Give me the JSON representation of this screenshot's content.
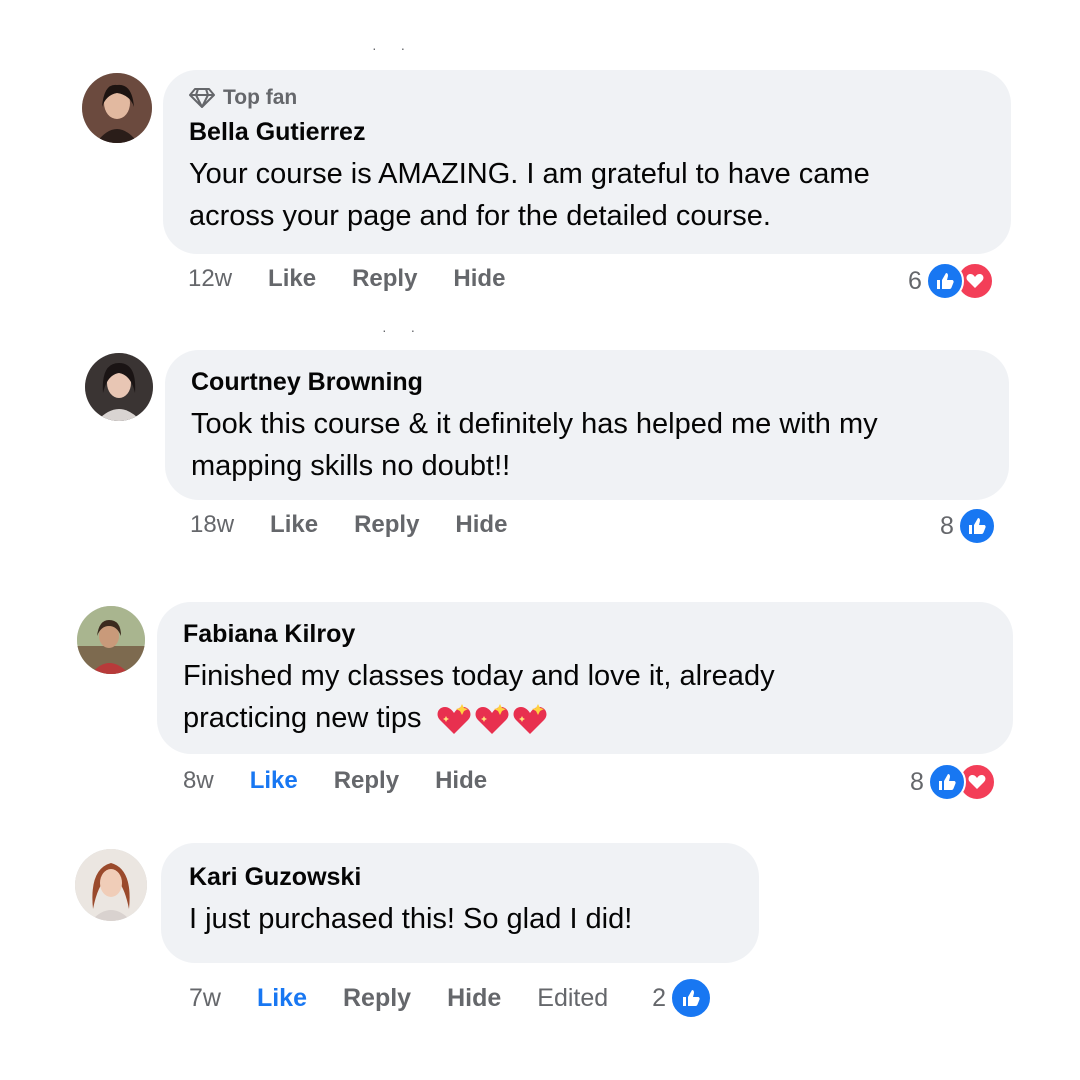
{
  "comments": [
    {
      "badge": "Top fan",
      "name": "Bella Gutierrez",
      "text_line1": "Your course is AMAZING. I am grateful to have came",
      "text_line2": "across your page and for the detailed course.",
      "time": "12w",
      "like": "Like",
      "reply": "Reply",
      "hide": "Hide",
      "reaction_count": "6",
      "reactions": [
        "like-icon",
        "love-icon"
      ],
      "liked": false
    },
    {
      "name": "Courtney Browning",
      "text_line1": "Took this course & it definitely has helped me with my",
      "text_line2": "mapping skills no doubt!!",
      "time": "18w",
      "like": "Like",
      "reply": "Reply",
      "hide": "Hide",
      "reaction_count": "8",
      "reactions": [
        "like-icon"
      ],
      "liked": false
    },
    {
      "name": "Fabiana Kilroy",
      "text_line1": "Finished my classes today and love it, already",
      "text_line2": "practicing new tips",
      "emoji": "sparkling-heart-icon",
      "time": "8w",
      "like": "Like",
      "reply": "Reply",
      "hide": "Hide",
      "reaction_count": "8",
      "reactions": [
        "like-icon",
        "love-icon"
      ],
      "liked": true
    },
    {
      "name": "Kari Guzowski",
      "text_line1": "I just purchased this! So glad I did!",
      "time": "7w",
      "like": "Like",
      "reply": "Reply",
      "hide": "Hide",
      "edited": "Edited",
      "reaction_count": "2",
      "reactions": [
        "like-icon"
      ],
      "liked": true
    }
  ],
  "colors": {
    "bubble": "#f0f2f5",
    "secondary_text": "#65676b",
    "like_blue": "#1877f2",
    "love_red": "#f33e58"
  }
}
